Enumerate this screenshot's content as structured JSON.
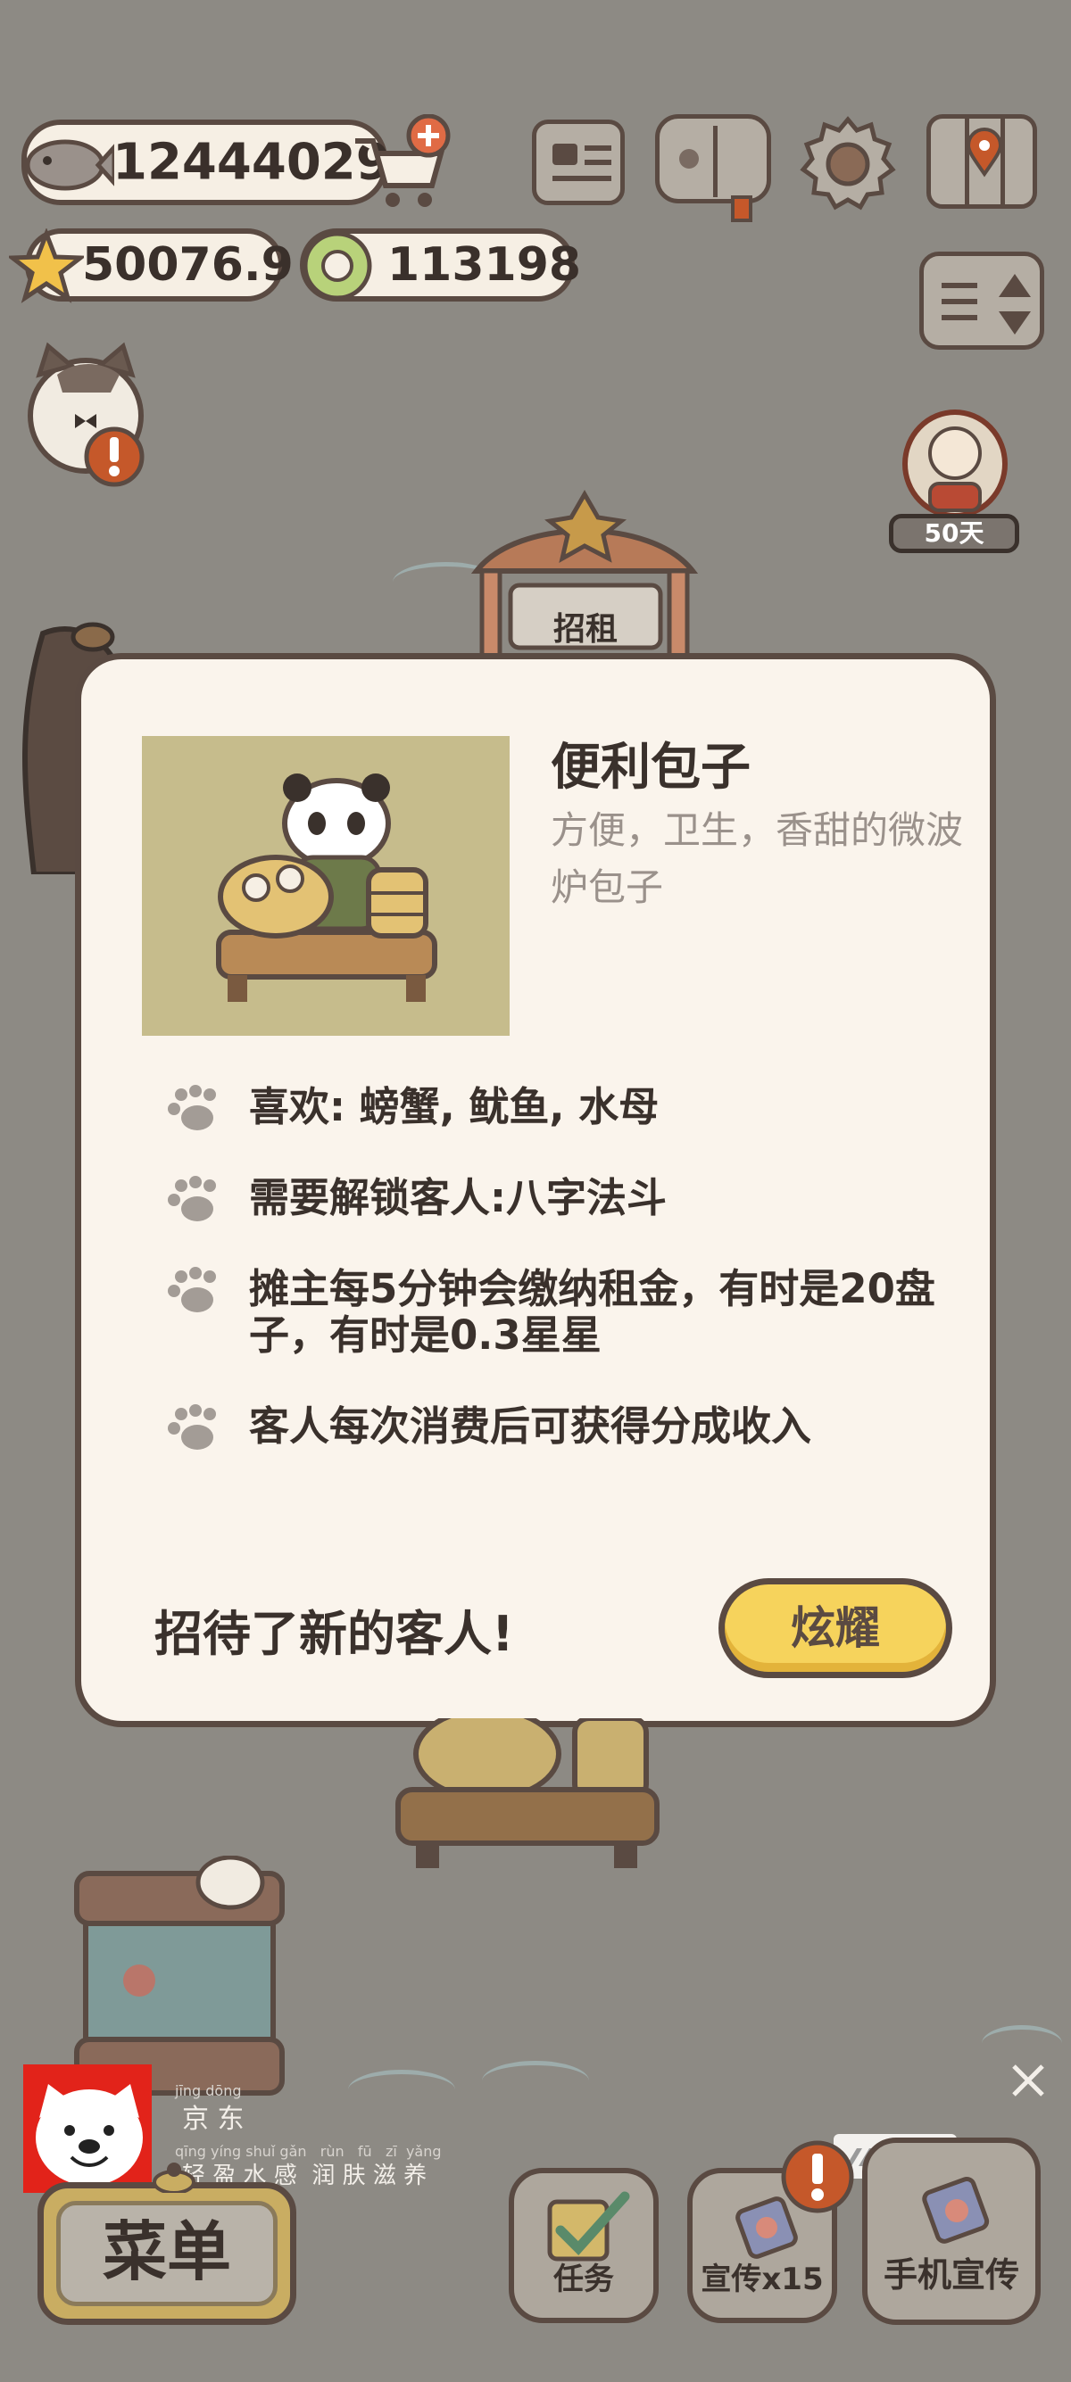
{
  "resources": {
    "fish": "12444029",
    "stars": "50076.9",
    "coins": "113198"
  },
  "booth_sign": "招租",
  "visitor_badge": "50天",
  "dialog": {
    "title": "便利包子",
    "description": "方便，卫生，香甜的微波炉包子",
    "features": [
      "喜欢: 螃蟹, 鱿鱼, 水母",
      "需要解锁客人:八字法斗",
      "摊主每5分钟会缴纳租金，有时是20盘子，有时是0.3星星",
      "客人每次消费后可获得分成收入"
    ],
    "footer_text": "招待了新的客人!",
    "show_button": "炫耀"
  },
  "ad": {
    "brand_pinyin": "jīng dōng",
    "brand": "京 东",
    "slogan_pinyin": "qīng yíng shuǐ gǎn   rùn   fū   zī  yǎng",
    "slogan": "轻 盈 水 感  润 肤 滋 养",
    "tag": "广告"
  },
  "bottom_bar": {
    "menu": "菜单",
    "tasks": "任务",
    "promote": "宣传x15",
    "phone_promote": "手机宣传"
  },
  "colors": {
    "outline": "#5a4a42",
    "panel": "#faf4ec",
    "accent_yellow": "#f6d35c",
    "alert_orange": "#c5582a"
  }
}
